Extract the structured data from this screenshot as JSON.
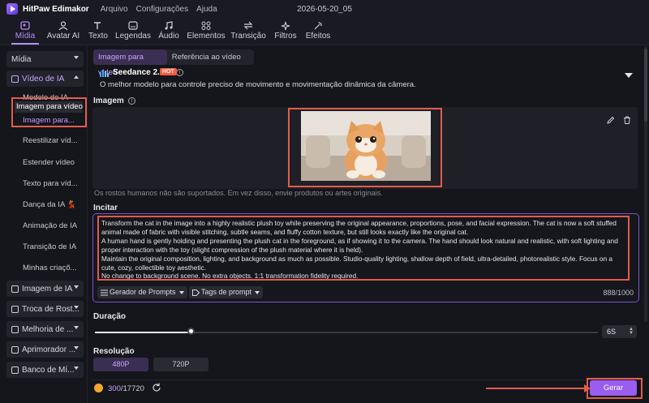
{
  "titlebar": {
    "app_name": "HitPaw Edimakor",
    "menus": [
      "Arquivo",
      "Configurações",
      "Ajuda"
    ],
    "project": "2026-05-20_05"
  },
  "toolbar": {
    "items": [
      "Mídia",
      "Avatar AI",
      "Texto",
      "Legendas",
      "Áudio",
      "Elementos",
      "Transição",
      "Filtros",
      "Efeitos"
    ],
    "active": "Mídia"
  },
  "sidebar": {
    "groups_top": [
      "Mídia",
      "Vídeo de IA"
    ],
    "tooltip": "Imagem para vídeo",
    "sub_items": [
      "Modelo de IA",
      "Imagem para...",
      "Reestilizar víd...",
      "Estender vídeo",
      "Texto para víd...",
      "Dança da IA 💃",
      "Animação de IA",
      "Transição de IA",
      "Minhas criaçõ..."
    ],
    "groups_bottom": [
      "Imagem de IA",
      "Troca de Rost...",
      "Melhoria de ...",
      "Aprimorador ...",
      "Banco de Mí..."
    ]
  },
  "tabs": {
    "image_to_video": "Imagem para vídeo",
    "reference_video": "Referência ao vídeo"
  },
  "model": {
    "name": "Seedance 2.0",
    "badge": "HOT",
    "description": "O melhor modelo para controle preciso de movimento e movimentação dinâmica da câmera."
  },
  "image_section": {
    "label": "Imagem",
    "note": "Os rostos humanos não são suportados. Em vez disso, envie produtos ou artes originais."
  },
  "prompt": {
    "label": "Incitar",
    "text": "Transform the cat in the image into a highly realistic plush toy while preserving the original appearance, proportions, pose, and facial expression. The cat is now a soft stuffed animal made of fabric with visible stitching, subtle seams, and fluffy cotton texture, but still looks exactly like the original cat.\nA human hand is gently holding and presenting the plush cat in the foreground, as if showing it to the camera. The hand should look natural and realistic, with soft lighting and proper interaction with the toy (slight compression of the plush material where it is held).\nMaintain the original composition, lighting, and background as much as possible. Studio-quality lighting, shallow depth of field, ultra-detailed, photorealistic style. Focus on a cute, cozy, collectible toy aesthetic.\nNo change to background scene. No extra objects. 1:1 transformation fidelity required.",
    "generator_button": "Gerador de Prompts",
    "tags_button": "Tags de prompt",
    "counter": "888/1000"
  },
  "duration": {
    "label": "Duração",
    "value": "6S",
    "fraction": 0.19
  },
  "resolution": {
    "label": "Resolução",
    "options": [
      "480P",
      "720P"
    ],
    "selected": "480P"
  },
  "credits": {
    "used": "300",
    "total": "/17720"
  },
  "generate_button": "Gerar",
  "colors": {
    "accent": "#9b5cf0",
    "accent_text": "#c9a4ff",
    "highlight": "#e25c4a",
    "hot_badge": "#ff5a3c"
  }
}
